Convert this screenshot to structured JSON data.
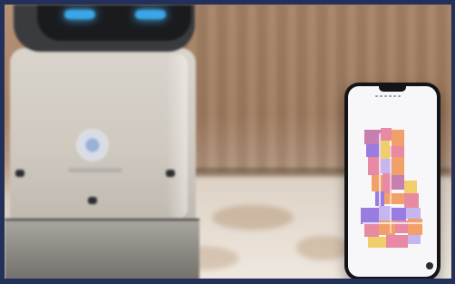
{
  "nav": {
    "items": [
      "",
      "",
      "",
      "",
      ""
    ],
    "logo": ""
  },
  "phone": {
    "stats": [
      {
        "value": "",
        "label": ""
      },
      {
        "value": "",
        "label": ""
      }
    ]
  },
  "colors": {
    "frame": "#22305a",
    "robot_eye": "#3aa6e8",
    "map_pink": "#e88aa4",
    "map_orange": "#f2a06a",
    "map_purple": "#9a7be0",
    "map_lavender": "#c6b6f0",
    "map_yellow": "#f0cf6a"
  }
}
